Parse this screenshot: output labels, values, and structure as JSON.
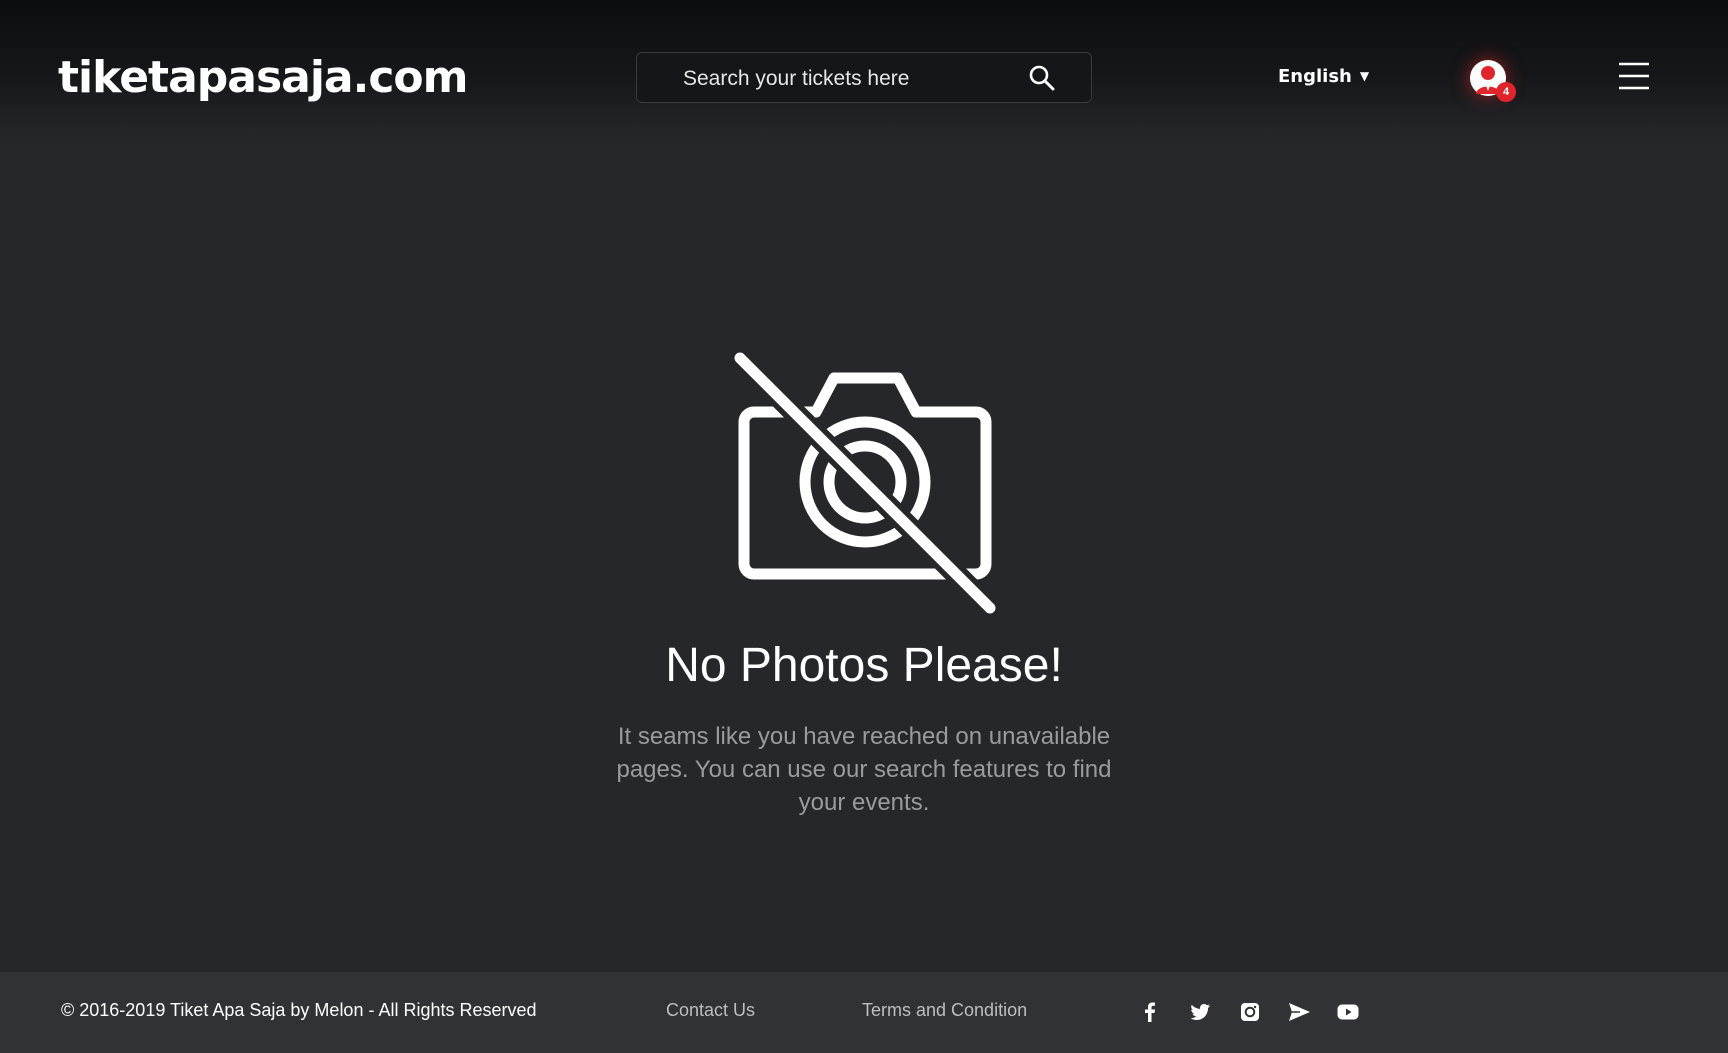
{
  "header": {
    "logo_text": "tiketapasaja.com",
    "search": {
      "placeholder": "Search your tickets here"
    },
    "language": {
      "selected": "English"
    },
    "notification_count": "4"
  },
  "main": {
    "title": "No Photos Please!",
    "description": "It seams like you have reached on unavailable pages. You can use our search features to find your events."
  },
  "footer": {
    "copyright": "© 2016-2019 Tiket Apa Saja by Melon - All Rights Reserved",
    "links": [
      "Contact Us",
      "Terms and Condition"
    ],
    "social_icons": [
      "facebook-icon",
      "twitter-icon",
      "instagram-icon",
      "send-icon",
      "youtube-icon"
    ]
  },
  "colors": {
    "background": "#26272a",
    "header_top": "#0c0d0f",
    "footer": "#313235",
    "accent_red": "#e0242b",
    "muted_text": "#9a9b9e"
  }
}
